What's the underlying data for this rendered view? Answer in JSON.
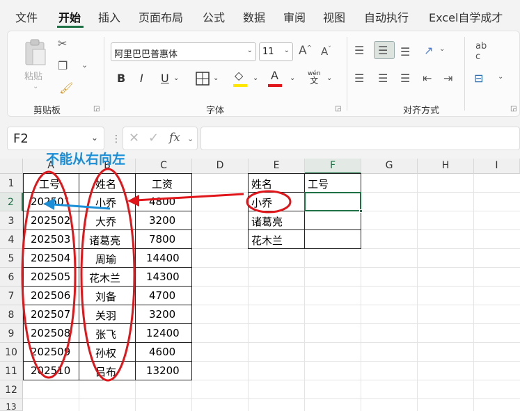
{
  "menu": {
    "items": [
      "文件",
      "开始",
      "插入",
      "页面布局",
      "公式",
      "数据",
      "审阅",
      "视图",
      "自动执行",
      "Excel自学成才"
    ],
    "active": "开始"
  },
  "ribbon": {
    "clipboard": {
      "paste_label": "粘贴",
      "group_label": "剪贴板"
    },
    "font": {
      "font_name": "阿里巴巴普惠体",
      "font_size": "11",
      "group_label": "字体",
      "wen": "wén",
      "wen2": "文"
    },
    "alignment": {
      "group_label": "对齐方式"
    },
    "accent_color": "#1e7145"
  },
  "formula_bar": {
    "name_box": "F2",
    "fx_label": "fx",
    "value": ""
  },
  "sheet": {
    "columns": [
      "A",
      "B",
      "C",
      "D",
      "E",
      "F",
      "G",
      "H",
      "I"
    ],
    "rows": [
      "1",
      "2",
      "3",
      "4",
      "5",
      "6",
      "7",
      "8",
      "9",
      "10",
      "11",
      "12",
      "13"
    ],
    "selected_cell": "F2",
    "table1": {
      "headers": [
        "工号",
        "姓名",
        "工资"
      ],
      "rows": [
        [
          "202501",
          "小乔",
          "4800"
        ],
        [
          "202502",
          "大乔",
          "3200"
        ],
        [
          "202503",
          "诸葛亮",
          "7800"
        ],
        [
          "202504",
          "周瑜",
          "14400"
        ],
        [
          "202505",
          "花木兰",
          "14300"
        ],
        [
          "202506",
          "刘备",
          "4700"
        ],
        [
          "202507",
          "关羽",
          "3200"
        ],
        [
          "202508",
          "张飞",
          "12400"
        ],
        [
          "202509",
          "孙权",
          "4600"
        ],
        [
          "202510",
          "吕布",
          "13200"
        ]
      ]
    },
    "table2": {
      "headers": [
        "姓名",
        "工号"
      ],
      "rows": [
        [
          "小乔",
          ""
        ],
        [
          "诸葛亮",
          ""
        ],
        [
          "花木兰",
          ""
        ]
      ]
    }
  },
  "annotation": {
    "text": "不能从右向左",
    "text_color": "#1a8fd8",
    "ellipse_color": "#e0161b",
    "arrow_color": "#1a8fd8"
  }
}
